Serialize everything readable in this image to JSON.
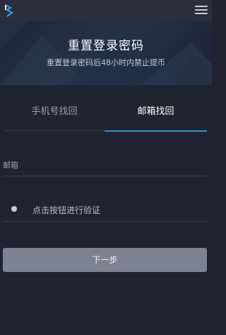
{
  "header": {
    "logo_icon": "exchange-logo-icon",
    "menu_icon": "hamburger-menu-icon"
  },
  "banner": {
    "title": "重置登录密码",
    "subtitle": "重置登录密码后48小时内禁止提币"
  },
  "tabs": [
    {
      "label": "手机号找回",
      "active": false
    },
    {
      "label": "邮箱找回",
      "active": true
    }
  ],
  "form": {
    "email_placeholder": "邮箱",
    "email_value": "",
    "verify_label": "点击按钮进行验证",
    "next_label": "下一步"
  },
  "colors": {
    "background": "#1f2430",
    "accent": "#2f8fdc",
    "button": "#7b8290"
  }
}
